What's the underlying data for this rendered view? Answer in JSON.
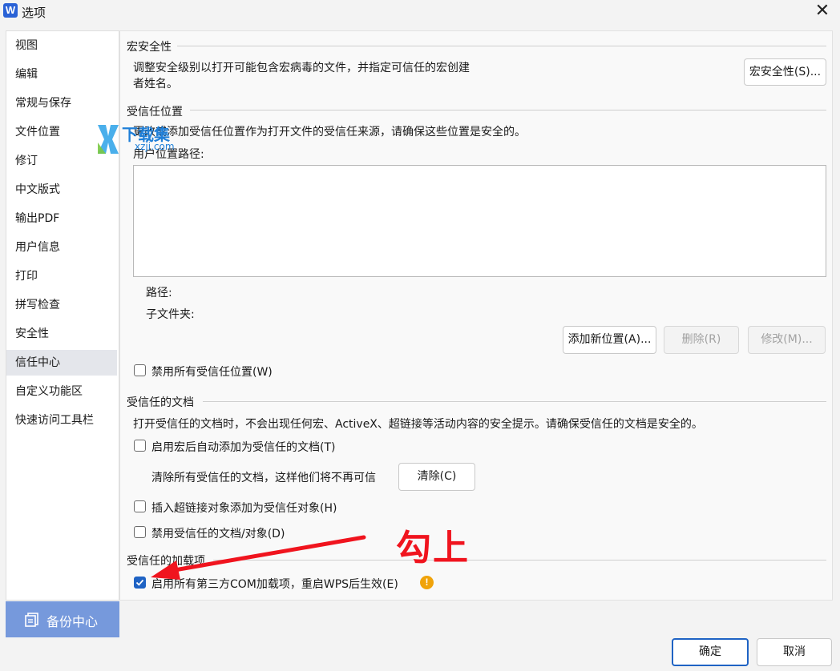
{
  "window": {
    "app_icon_letter": "W",
    "title": "选项",
    "close_glyph": "✕"
  },
  "sidebar": {
    "items": [
      {
        "label": "视图"
      },
      {
        "label": "编辑"
      },
      {
        "label": "常规与保存"
      },
      {
        "label": "文件位置"
      },
      {
        "label": "修订"
      },
      {
        "label": "中文版式"
      },
      {
        "label": "输出PDF"
      },
      {
        "label": "用户信息"
      },
      {
        "label": "打印"
      },
      {
        "label": "拼写检查"
      },
      {
        "label": "安全性"
      },
      {
        "label": "信任中心",
        "selected": true
      },
      {
        "label": "自定义功能区"
      },
      {
        "label": "快速访问工具栏"
      }
    ],
    "backup": {
      "label": "备份中心",
      "icon": "backup-icon"
    }
  },
  "macro_security": {
    "heading": "宏安全性",
    "description_line1": "调整安全级别以打开可能包含宏病毒的文件，并指定可信任的宏创建",
    "description_line2": "者姓名。",
    "button_label": "宏安全性(S)..."
  },
  "trusted_locations": {
    "heading": "受信任位置",
    "description": "更改或添加受信任位置作为打开文件的受信任来源，请确保这些位置是安全的。",
    "list_header": "用户位置路径:",
    "path_label": "路径:",
    "subfolder_label": "子文件夹:",
    "add_button": "添加新位置(A)...",
    "delete_button": "删除(R)",
    "modify_button": "修改(M)...",
    "disable_all_checkbox": {
      "label": "禁用所有受信任位置(W)",
      "checked": false
    }
  },
  "trusted_documents": {
    "heading": "受信任的文档",
    "description": "打开受信任的文档时，不会出现任何宏、ActiveX、超链接等活动内容的安全提示。请确保受信任的文档是安全的。",
    "auto_add_checkbox": {
      "label": "启用宏后自动添加为受信任的文档(T)",
      "checked": false
    },
    "clear_text": "清除所有受信任的文档，这样他们将不再可信",
    "clear_button": "清除(C)",
    "hyperlink_checkbox": {
      "label": "插入超链接对象添加为受信任对象(H)",
      "checked": false
    },
    "disable_checkbox": {
      "label": "禁用受信任的文档/对象(D)",
      "checked": false
    }
  },
  "trusted_addins": {
    "heading": "受信任的加载项",
    "enable_com_checkbox": {
      "label": "启用所有第三方COM加载项，重启WPS后生效(E)",
      "checked": true
    },
    "warning_glyph": "!"
  },
  "watermark": {
    "text": "下载集",
    "sub": "xzji.com"
  },
  "annotation": {
    "text": "勾上",
    "color": "#f0141e"
  },
  "footer": {
    "ok_label": "确定",
    "cancel_label": "取消"
  },
  "colors": {
    "accent": "#1f63c4",
    "sidebar_selected": "#e4e6eb",
    "backup_bg": "#7699dc",
    "warning": "#f0a30a"
  }
}
